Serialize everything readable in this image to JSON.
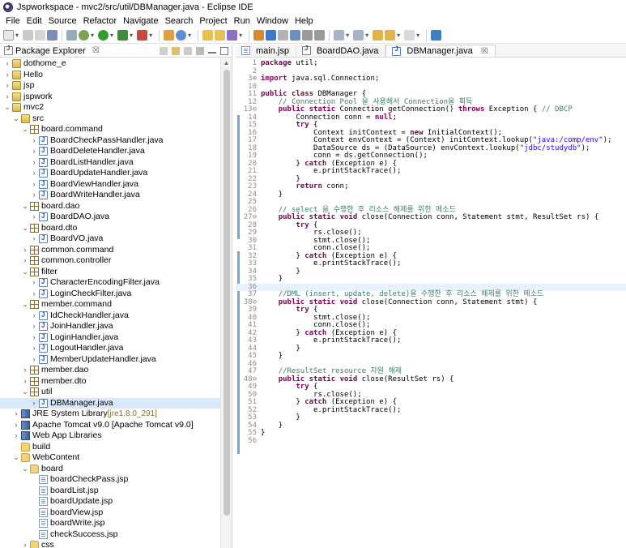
{
  "window": {
    "title": "Jspworkspace - mvc2/src/util/DBManager.java - Eclipse IDE"
  },
  "menu": [
    "File",
    "Edit",
    "Source",
    "Refactor",
    "Navigate",
    "Search",
    "Project",
    "Run",
    "Window",
    "Help"
  ],
  "explorer": {
    "title": "Package Explorer",
    "close": "☒",
    "items": [
      {
        "label": "dothome_e",
        "icon": "project-icon",
        "indent": 0,
        "chev": "›"
      },
      {
        "label": "Hello",
        "icon": "project-icon",
        "indent": 0,
        "chev": "›"
      },
      {
        "label": "jsp",
        "icon": "project-icon",
        "indent": 0,
        "chev": "›"
      },
      {
        "label": "jspwork",
        "icon": "project-icon",
        "indent": 0,
        "chev": "›"
      },
      {
        "label": "mvc2",
        "icon": "project-icon",
        "indent": 0,
        "chev": "⌄"
      },
      {
        "label": "src",
        "icon": "source-folder-icon",
        "indent": 1,
        "chev": "⌄"
      },
      {
        "label": "board.command",
        "icon": "package-icon",
        "indent": 2,
        "chev": "⌄"
      },
      {
        "label": "BoardCheckPassHandler.java",
        "icon": "java-file-icon",
        "indent": 3,
        "chev": "›"
      },
      {
        "label": "BoardDeleteHandler.java",
        "icon": "java-file-icon",
        "indent": 3,
        "chev": "›"
      },
      {
        "label": "BoardListHandler.java",
        "icon": "java-file-icon",
        "indent": 3,
        "chev": "›"
      },
      {
        "label": "BoardUpdateHandler.java",
        "icon": "java-file-icon",
        "indent": 3,
        "chev": "›"
      },
      {
        "label": "BoardViewHandler.java",
        "icon": "java-file-icon",
        "indent": 3,
        "chev": "›"
      },
      {
        "label": "BoardWriteHandler.java",
        "icon": "java-file-icon",
        "indent": 3,
        "chev": "›"
      },
      {
        "label": "board.dao",
        "icon": "package-icon",
        "indent": 2,
        "chev": "⌄"
      },
      {
        "label": "BoardDAO.java",
        "icon": "java-file-icon",
        "indent": 3,
        "chev": "›"
      },
      {
        "label": "board.dto",
        "icon": "package-icon",
        "indent": 2,
        "chev": "⌄"
      },
      {
        "label": "BoardVO.java",
        "icon": "java-file-icon",
        "indent": 3,
        "chev": "›"
      },
      {
        "label": "common.command",
        "icon": "package-icon",
        "indent": 2,
        "chev": "›"
      },
      {
        "label": "common.controller",
        "icon": "package-icon",
        "indent": 2,
        "chev": "›"
      },
      {
        "label": "filter",
        "icon": "package-icon",
        "indent": 2,
        "chev": "⌄"
      },
      {
        "label": "CharacterEncodingFilter.java",
        "icon": "java-file-icon",
        "indent": 3,
        "chev": "›"
      },
      {
        "label": "LoginCheckFilter.java",
        "icon": "java-file-icon",
        "indent": 3,
        "chev": "›"
      },
      {
        "label": "member.command",
        "icon": "package-icon",
        "indent": 2,
        "chev": "⌄"
      },
      {
        "label": "IdCheckHandler.java",
        "icon": "java-file-icon",
        "indent": 3,
        "chev": "›"
      },
      {
        "label": "JoinHandler.java",
        "icon": "java-file-icon",
        "indent": 3,
        "chev": "›"
      },
      {
        "label": "LoginHandler.java",
        "icon": "java-file-icon",
        "indent": 3,
        "chev": "›"
      },
      {
        "label": "LogoutHandler.java",
        "icon": "java-file-icon",
        "indent": 3,
        "chev": "›"
      },
      {
        "label": "MemberUpdateHandler.java",
        "icon": "java-file-icon",
        "indent": 3,
        "chev": "›"
      },
      {
        "label": "member.dao",
        "icon": "package-icon",
        "indent": 2,
        "chev": "›"
      },
      {
        "label": "member.dto",
        "icon": "package-icon",
        "indent": 2,
        "chev": "›"
      },
      {
        "label": "util",
        "icon": "package-icon",
        "indent": 2,
        "chev": "⌄"
      },
      {
        "label": "DBManager.java",
        "icon": "java-file-icon",
        "indent": 3,
        "chev": "›",
        "selected": true
      },
      {
        "label": "JRE System Library",
        "deco": " [jre1.8.0_291]",
        "icon": "library-icon",
        "indent": 1,
        "chev": "›"
      },
      {
        "label": "Apache Tomcat v9.0 [Apache Tomcat v9.0]",
        "icon": "library-icon",
        "indent": 1,
        "chev": "›"
      },
      {
        "label": "Web App Libraries",
        "icon": "library-icon",
        "indent": 1,
        "chev": "›"
      },
      {
        "label": "build",
        "icon": "folder-icon",
        "indent": 1,
        "chev": ""
      },
      {
        "label": "WebContent",
        "icon": "folder-icon",
        "indent": 1,
        "chev": "⌄"
      },
      {
        "label": "board",
        "icon": "folder-icon",
        "indent": 2,
        "chev": "⌄"
      },
      {
        "label": "boardCheckPass.jsp",
        "icon": "jsp-file-icon",
        "indent": 3,
        "chev": ""
      },
      {
        "label": "boardList.jsp",
        "icon": "jsp-file-icon",
        "indent": 3,
        "chev": ""
      },
      {
        "label": "boardUpdate.jsp",
        "icon": "jsp-file-icon",
        "indent": 3,
        "chev": ""
      },
      {
        "label": "boardView.jsp",
        "icon": "jsp-file-icon",
        "indent": 3,
        "chev": ""
      },
      {
        "label": "boardWrite.jsp",
        "icon": "jsp-file-icon",
        "indent": 3,
        "chev": ""
      },
      {
        "label": "checkSuccess.jsp",
        "icon": "jsp-file-icon",
        "indent": 3,
        "chev": ""
      },
      {
        "label": "css",
        "icon": "folder-icon",
        "indent": 2,
        "chev": "›"
      }
    ]
  },
  "editor": {
    "tabs": [
      {
        "label": "main.jsp",
        "active": false
      },
      {
        "label": "BoardDAO.java",
        "active": false
      },
      {
        "label": "DBManager.java",
        "active": true,
        "close": "☒"
      }
    ],
    "lines": [
      {
        "n": "1",
        "t": "package util;"
      },
      {
        "n": "2",
        "t": ""
      },
      {
        "n": "3⊕",
        "t": "import java.sql.Connection;"
      },
      {
        "n": "10",
        "t": ""
      },
      {
        "n": "11",
        "t": "public class DBManager {"
      },
      {
        "n": "12",
        "t": "    // Connection Pool 을 사용해서 Connection을 획득"
      },
      {
        "n": "13⊖",
        "t": "    public static Connection getConnection() throws Exception { // DBCP"
      },
      {
        "n": "14",
        "t": "        Connection conn = null;"
      },
      {
        "n": "15",
        "t": "        try {"
      },
      {
        "n": "16",
        "t": "            Context initContext = new InitialContext();"
      },
      {
        "n": "17",
        "t": "            Context envContext = (Context) initContext.lookup(\"java:/comp/env\");"
      },
      {
        "n": "18",
        "t": "            DataSource ds = (DataSource) envContext.lookup(\"jdbc/studydb\");"
      },
      {
        "n": "19",
        "t": "            conn = ds.getConnection();"
      },
      {
        "n": "20",
        "t": "        } catch (Exception e) {"
      },
      {
        "n": "21",
        "t": "            e.printStackTrace();"
      },
      {
        "n": "22",
        "t": "        }"
      },
      {
        "n": "23",
        "t": "        return conn;"
      },
      {
        "n": "24",
        "t": "    }"
      },
      {
        "n": "25",
        "t": ""
      },
      {
        "n": "26",
        "t": "    // select 을 수행한 후 리소스 해제를 위한 메소드"
      },
      {
        "n": "27⊖",
        "t": "    public static void close(Connection conn, Statement stmt, ResultSet rs) {"
      },
      {
        "n": "28",
        "t": "        try {"
      },
      {
        "n": "29",
        "t": "            rs.close();"
      },
      {
        "n": "30",
        "t": "            stmt.close();"
      },
      {
        "n": "31",
        "t": "            conn.close();"
      },
      {
        "n": "32",
        "t": "        } catch (Exception e) {"
      },
      {
        "n": "33",
        "t": "            e.printStackTrace();"
      },
      {
        "n": "34",
        "t": "        }"
      },
      {
        "n": "35",
        "t": "    }"
      },
      {
        "n": "36",
        "t": "",
        "hl": true
      },
      {
        "n": "37",
        "t": "    //DML (insert, update, delete)을 수행한 후 리소스 해제를 위한 메소드"
      },
      {
        "n": "38⊖",
        "t": "    public static void close(Connection conn, Statement stmt) {"
      },
      {
        "n": "39",
        "t": "        try {"
      },
      {
        "n": "40",
        "t": "            stmt.close();"
      },
      {
        "n": "41",
        "t": "            conn.close();"
      },
      {
        "n": "42",
        "t": "        } catch (Exception e) {"
      },
      {
        "n": "43",
        "t": "            e.printStackTrace();"
      },
      {
        "n": "44",
        "t": "        }"
      },
      {
        "n": "45",
        "t": "    }"
      },
      {
        "n": "46",
        "t": ""
      },
      {
        "n": "47",
        "t": "    //ResultSet resource 자원 해제"
      },
      {
        "n": "48⊖",
        "t": "    public static void close(ResultSet rs) {"
      },
      {
        "n": "49",
        "t": "        try {"
      },
      {
        "n": "50",
        "t": "            rs.close();"
      },
      {
        "n": "51",
        "t": "        } catch (Exception e) {"
      },
      {
        "n": "52",
        "t": "            e.printStackTrace();"
      },
      {
        "n": "53",
        "t": "        }"
      },
      {
        "n": "54",
        "t": "    }"
      },
      {
        "n": "55",
        "t": "}"
      },
      {
        "n": "56",
        "t": ""
      }
    ]
  },
  "colors": {
    "keyword": "#7f0055",
    "comment": "#3f7f5f",
    "string": "#2a00ff",
    "selection": "#d9e8fb",
    "currentLine": "#e8f2fe"
  }
}
